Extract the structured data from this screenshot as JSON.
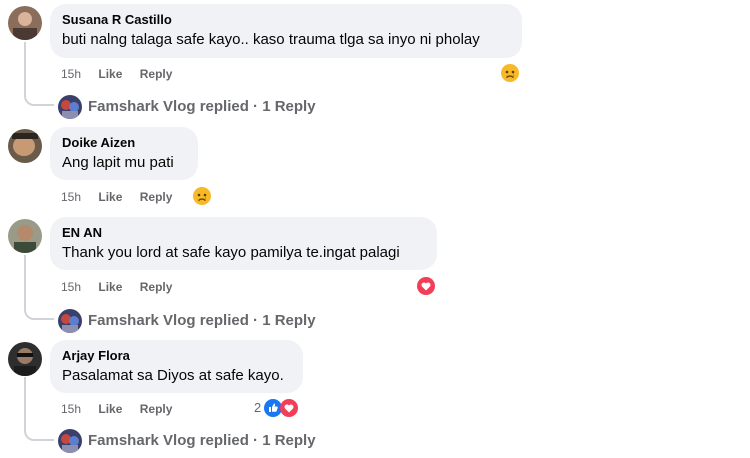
{
  "comments": [
    {
      "author": "Susana R Castillo",
      "text": "buti nalng talaga safe kayo.. kaso trauma tlga sa inyo ni pholay",
      "time": "15h",
      "like": "Like",
      "reply": "Reply",
      "reactions": [
        "sad"
      ],
      "reply_summary": "Famshark Vlog replied · 1 Reply"
    },
    {
      "author": "Doike Aizen",
      "text": "Ang lapit mu pati",
      "time": "15h",
      "like": "Like",
      "reply": "Reply",
      "reactions": [
        "sad"
      ]
    },
    {
      "author": "EN AN",
      "text": "Thank you lord at safe kayo pamilya te.ingat palagi",
      "time": "15h",
      "like": "Like",
      "reply": "Reply",
      "reactions": [
        "love"
      ],
      "reply_summary": "Famshark Vlog replied · 1 Reply"
    },
    {
      "author": "Arjay Flora",
      "text": "Pasalamat sa Diyos at safe kayo.",
      "time": "15h",
      "like": "Like",
      "reply": "Reply",
      "reaction_count": "2",
      "reactions": [
        "like",
        "love"
      ],
      "reply_summary": "Famshark Vlog replied · 1 Reply"
    }
  ],
  "colors": {
    "bubble": "#f0f2f5",
    "meta": "#65676b",
    "like_blue": "#1877f2",
    "love_red": "#f33e58",
    "sad_yellow": "#f7b928"
  }
}
